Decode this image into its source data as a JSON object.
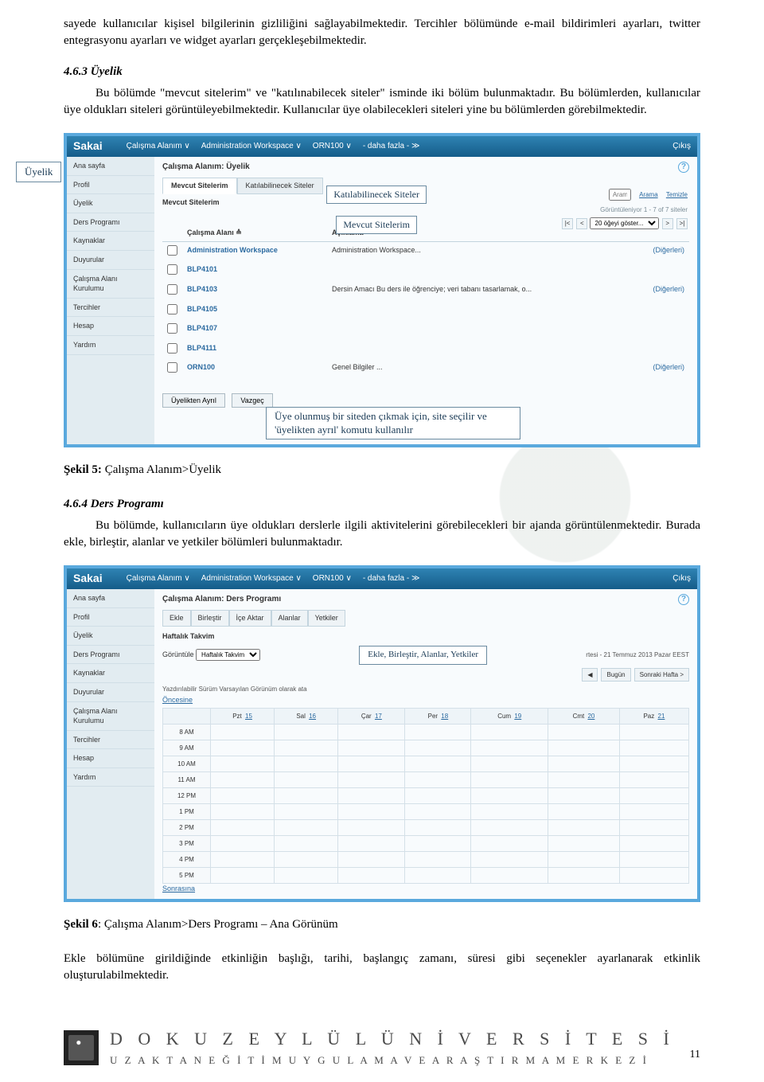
{
  "intro_para": "sayede kullanıcılar kişisel bilgilerinin gizliliğini sağlayabilmektedir. Tercihler bölümünde e-mail bildirimleri ayarları, twitter entegrasyonu ayarları ve widget ayarları gerçekleşebilmektedir.",
  "sec_4_6_3": {
    "title": "4.6.3 Üyelik",
    "body": "Bu bölümde \"mevcut sitelerim\" ve \"katılınabilecek siteler\" isminde iki bölüm bulunmaktadır. Bu bölümlerden, kullanıcılar üye oldukları siteleri görüntüleyebilmektedir. Kullanıcılar üye olabilecekleri siteleri yine bu bölümlerden görebilmektedir."
  },
  "callouts": {
    "uyelik": "Üyelik",
    "katilabilinecek": "Katılabilinecek Siteler",
    "mevcut": "Mevcut Sitelerim",
    "ayril": "Üye olunmuş bir siteden çıkmak için, site seçilir ve 'üyelikten ayrıl' komutu kullanılır",
    "ekle": "Ekle, Birleştir, Alanlar, Yetkiler"
  },
  "shot1": {
    "brand": "Sakai",
    "nav": [
      "Çalışma Alanım ∨",
      "Administration Workspace ∨",
      "ORN100 ∨",
      "- daha fazla - ≫"
    ],
    "logout": "Çıkış",
    "sidebar": [
      "Ana sayfa",
      "Profil",
      "Üyelik",
      "Ders Programı",
      "Kaynaklar",
      "Duyurular",
      "Çalışma Alanı Kurulumu",
      "Tercihler",
      "Hesap",
      "Yardım"
    ],
    "breadcrumb": "Çalışma Alanım: Üyelik",
    "tabs": {
      "a": "Mevcut Sitelerim",
      "b": "Katılabilinecek Siteler"
    },
    "subtitle": "Mevcut Sitelerim",
    "search": {
      "arama": "Arama",
      "temizle": "Temizle"
    },
    "range": "Görüntüleniyor 1 - 7 of 7 siteler",
    "show_select": "20 öğeyi göster...",
    "table_headers": {
      "alan": "Çalışma Alanı ≙",
      "aciklama": "Açıklama"
    },
    "rows": [
      {
        "alan": "Administration Workspace",
        "aciklama": "Administration Workspace...",
        "act": "(Diğerleri)"
      },
      {
        "alan": "BLP4101",
        "aciklama": "",
        "act": ""
      },
      {
        "alan": "BLP4103",
        "aciklama": "Dersin Amacı Bu ders ile öğrenciye; veri tabanı tasarlamak, o...",
        "act": "(Diğerleri)"
      },
      {
        "alan": "BLP4105",
        "aciklama": "",
        "act": ""
      },
      {
        "alan": "BLP4107",
        "aciklama": "",
        "act": ""
      },
      {
        "alan": "BLP4111",
        "aciklama": "",
        "act": ""
      },
      {
        "alan": "ORN100",
        "aciklama": "Genel Bilgiler ...",
        "act": "(Diğerleri)"
      }
    ],
    "buttons": {
      "ayril": "Üyelikten Ayrıl",
      "vazgec": "Vazgeç"
    }
  },
  "caption1": {
    "bold": "Şekil 5:",
    "rest": " Çalışma Alanım>Üyelik"
  },
  "sec_4_6_4": {
    "title": "4.6.4 Ders Programı",
    "body": "Bu bölümde, kullanıcıların üye oldukları derslerle ilgili aktivitelerini görebilecekleri bir ajanda görüntülenmektedir. Burada ekle, birleştir, alanlar ve yetkiler bölümleri bulunmaktadır."
  },
  "shot2": {
    "brand": "Sakai",
    "nav": [
      "Çalışma Alanım ∨",
      "Administration Workspace ∨",
      "ORN100 ∨",
      "- daha fazla - ≫"
    ],
    "logout": "Çıkış",
    "sidebar": [
      "Ana sayfa",
      "Profil",
      "Üyelik",
      "Ders Programı",
      "Kaynaklar",
      "Duyurular",
      "Çalışma Alanı Kurulumu",
      "Tercihler",
      "Hesap",
      "Yardım"
    ],
    "breadcrumb": "Çalışma Alanım: Ders Programı",
    "toolbar": [
      "Ekle",
      "Birleştir",
      "İçe Aktar",
      "Alanlar",
      "Yetkiler"
    ],
    "haftalik": "Haftalık Takvim",
    "goruntule": "Görüntüle",
    "goruntule_sel": "Haftalık Takvim",
    "date_text": "rtesi - 21 Temmuz 2013 Pazar EEST",
    "chips": {
      "onceki": "◀",
      "bugun": "Bugün",
      "sonraki": "Sonraki Hafta >"
    },
    "note": "Yazdırılabilir Sürüm    Varsayılan Görünüm olarak ata",
    "prev": "Öncesine",
    "next": "Sonrasına",
    "days": [
      {
        "d": "Pzt",
        "n": "15"
      },
      {
        "d": "Sal",
        "n": "16"
      },
      {
        "d": "Çar",
        "n": "17"
      },
      {
        "d": "Per",
        "n": "18"
      },
      {
        "d": "Cum",
        "n": "19"
      },
      {
        "d": "Cmt",
        "n": "20"
      },
      {
        "d": "Paz",
        "n": "21"
      }
    ],
    "times": [
      "8 AM",
      "9 AM",
      "10 AM",
      "11 AM",
      "12 PM",
      "1 PM",
      "2 PM",
      "3 PM",
      "4 PM",
      "5 PM"
    ]
  },
  "caption2": {
    "bold": "Şekil 6",
    "rest": ": Çalışma Alanım>Ders Programı – Ana Görünüm"
  },
  "closing_para": "Ekle bölümüne girildiğinde etkinliğin başlığı, tarihi, başlangıç zamanı, süresi gibi seçenekler ayarlanarak etkinlik oluşturulabilmektedir.",
  "footer": {
    "line1": "D O K U Z   E Y L Ü L   Ü N İ V E R S İ T E S İ",
    "line2": "U Z A K T A N   E Ğ İ T İ M   U Y G U L A M A   V E   A R A Ş T I R M A   M E R K E Z İ",
    "logo_alt": "DEUZEM"
  },
  "page_number": "11"
}
